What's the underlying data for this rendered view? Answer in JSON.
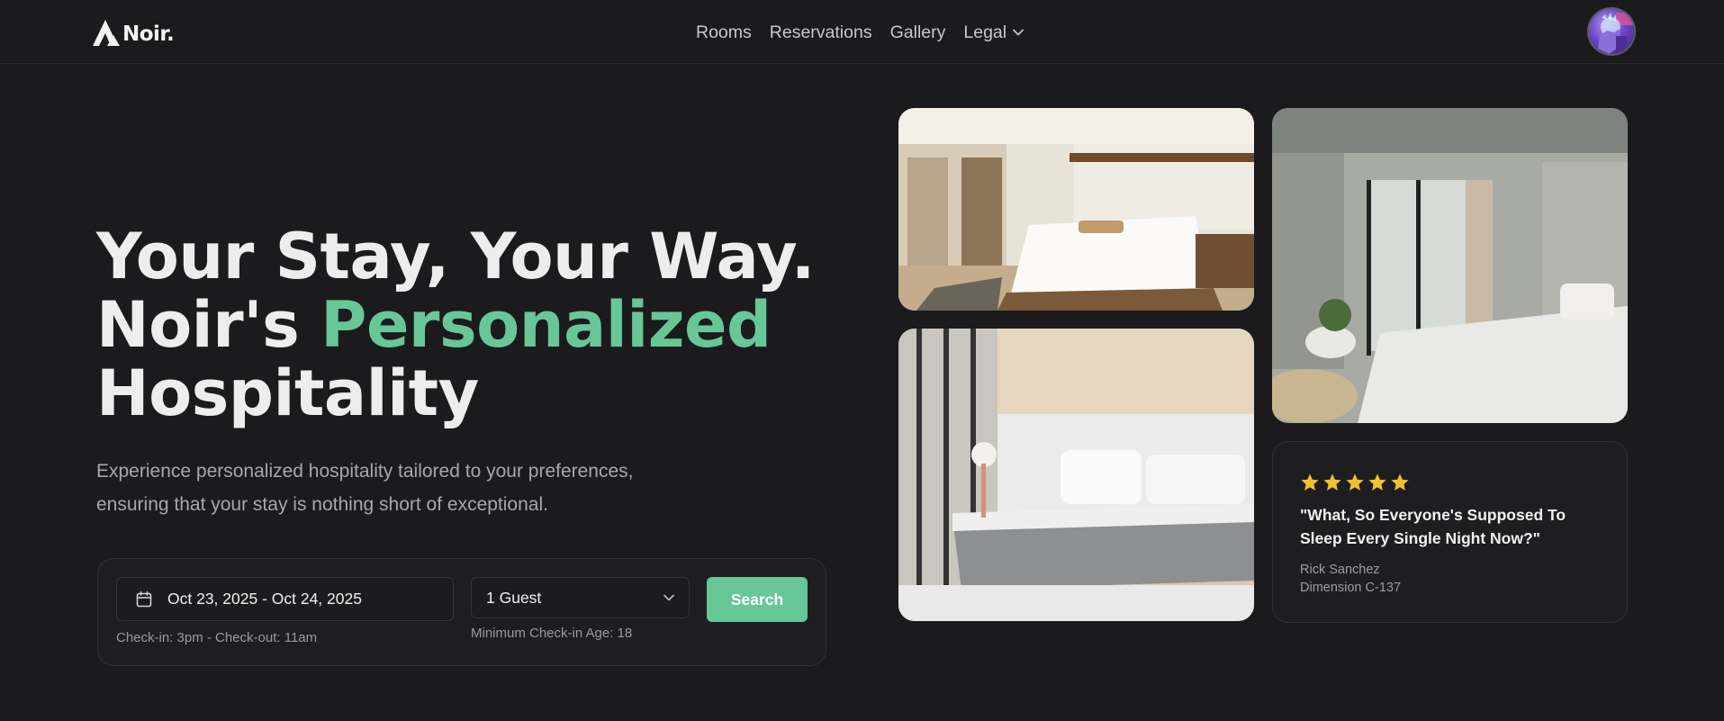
{
  "nav": {
    "logo_text": "Noir.",
    "links": [
      {
        "label": "Rooms"
      },
      {
        "label": "Reservations"
      },
      {
        "label": "Gallery"
      },
      {
        "label": "Legal",
        "has_dropdown": true
      }
    ],
    "avatar_icon": "user-avatar"
  },
  "hero": {
    "headline_line1": "Your Stay, Your Way.",
    "headline_line2_prefix": "Noir's ",
    "headline_line2_accent": "Personalized",
    "headline_line3": "Hospitality",
    "subtitle": "Experience personalized hospitality tailored to your preferences, ensuring that your stay is nothing short of exceptional.",
    "accent_color": "#67c797"
  },
  "search": {
    "date_range": "Oct 23, 2025 - Oct 24, 2025",
    "date_icon": "calendar-icon",
    "checkin_hint": "Check-in: 3pm - Check-out: 11am",
    "guests_value": "1 Guest",
    "guests_hint": "Minimum Check-in Age: 18",
    "button_label": "Search"
  },
  "gallery": {
    "images": [
      {
        "name": "bedroom-photo-1",
        "description": "bright bedroom with white padded headboard"
      },
      {
        "name": "bedroom-photo-2",
        "description": "modern bed with grey blanket"
      },
      {
        "name": "bedroom-photo-3",
        "description": "concrete walled bedroom with plant"
      }
    ]
  },
  "review": {
    "rating": 5,
    "quote": "\"What, So Everyone's Supposed To Sleep Every Single Night Now?\"",
    "author": "Rick Sanchez",
    "origin": "Dimension C-137",
    "star_color": "#f2c12e"
  }
}
